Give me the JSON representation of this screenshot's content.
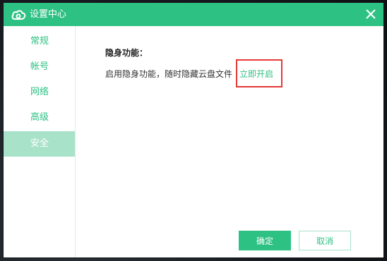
{
  "window": {
    "title": "设置中心",
    "close_label": "×"
  },
  "sidebar": {
    "items": [
      {
        "label": "常规"
      },
      {
        "label": "帐号"
      },
      {
        "label": "网络"
      },
      {
        "label": "高级"
      },
      {
        "label": "安全",
        "active": true
      }
    ]
  },
  "security": {
    "section_title": "隐身功能：",
    "description": "启用隐身功能，随时隐藏云盘文件",
    "enable_link": "立即开启"
  },
  "buttons": {
    "ok_label": "确定",
    "cancel_label": "取消"
  },
  "colors": {
    "accent": "#2ec184",
    "active_nav_bg": "#a8e3c9",
    "highlight": "#e53935"
  }
}
